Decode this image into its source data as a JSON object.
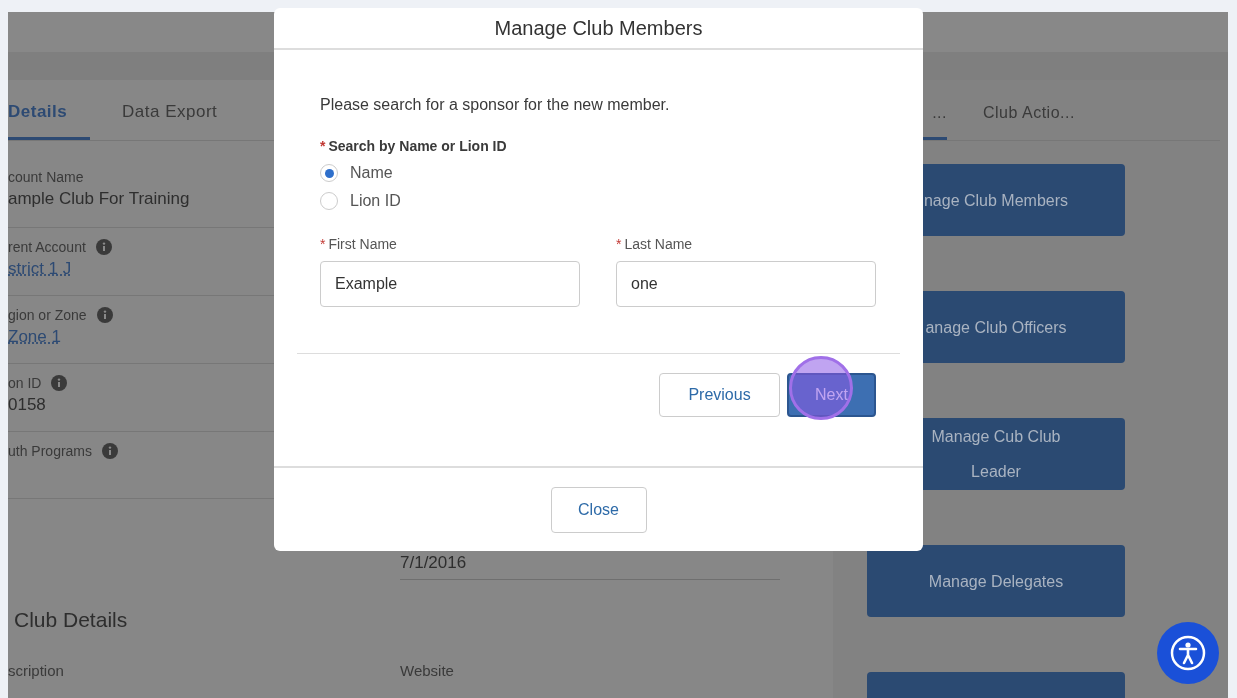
{
  "page": {
    "left_tabs": [
      {
        "label": "Details",
        "selected": true
      },
      {
        "label": "Data Export",
        "selected": false
      }
    ],
    "fields": [
      {
        "label": "count Name",
        "info": false,
        "value": "ample Club For Training",
        "kind": "text"
      },
      {
        "label": "rent Account",
        "info": true,
        "value": "strict 1 J",
        "kind": "link"
      },
      {
        "label": "gion or Zone",
        "info": true,
        "value": "Zone 1",
        "kind": "link"
      },
      {
        "label": "on ID",
        "info": true,
        "value": "0158",
        "kind": "text"
      },
      {
        "label": "uth Programs",
        "info": true
      }
    ],
    "date_value": "7/1/2016",
    "section_title": "Club Details",
    "section_labels": [
      "scription",
      "Website"
    ],
    "right_tabs": [
      {
        "label": "...",
        "selected": true
      },
      {
        "label": "Club Actio...",
        "selected": false
      }
    ],
    "actions": [
      {
        "kind": "button",
        "label": "nage Club Members"
      },
      {
        "kind": "button",
        "label": "anage Club Officers"
      },
      {
        "kind": "button",
        "label": "Manage Cub Club Leader"
      },
      {
        "kind": "button",
        "label": "Manage Delegates"
      },
      {
        "kind": "button"
      }
    ]
  },
  "modal": {
    "title": "Manage Club Members",
    "prompt": "Please search for a sponsor for the new member.",
    "search_label": "Search by Name or Lion ID",
    "search_required_mark": "*",
    "options": [
      {
        "label": "Name",
        "selected": true
      },
      {
        "label": "Lion ID",
        "selected": false
      }
    ],
    "fields": [
      {
        "label": "First Name",
        "required_mark": "*",
        "value": "Example"
      },
      {
        "label": "Last Name",
        "required_mark": "*",
        "value": "one"
      }
    ],
    "previous": "Previous",
    "next": "Next",
    "close": "Close"
  }
}
